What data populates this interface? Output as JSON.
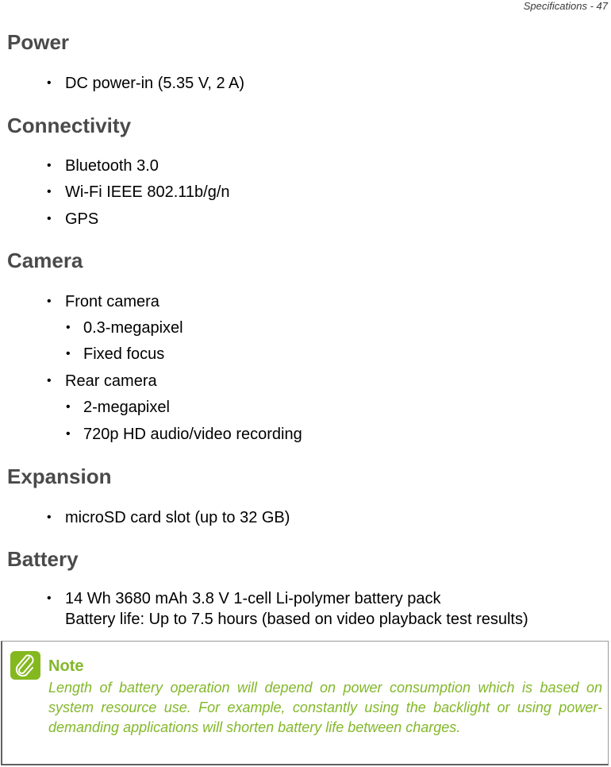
{
  "header": {
    "page_label": "Specifications - 47"
  },
  "sections": {
    "power": {
      "title": "Power",
      "items": [
        "DC power-in (5.35 V, 2 A)"
      ]
    },
    "connectivity": {
      "title": "Connectivity",
      "items": [
        "Bluetooth 3.0",
        "Wi-Fi IEEE 802.11b/g/n",
        "GPS"
      ]
    },
    "camera": {
      "title": "Camera",
      "front": {
        "label": "Front camera",
        "sub": [
          "0.3-megapixel",
          "Fixed focus"
        ]
      },
      "rear": {
        "label": "Rear camera",
        "sub": [
          "2-megapixel",
          "720p HD audio/video recording"
        ]
      }
    },
    "expansion": {
      "title": "Expansion",
      "items": [
        "microSD card slot (up to 32 GB)"
      ]
    },
    "battery": {
      "title": "Battery",
      "line1": "14 Wh 3680 mAh 3.8 V 1-cell Li-polymer battery pack",
      "line2": "Battery life: Up to 7.5 hours (based on video playback test results)"
    }
  },
  "note": {
    "icon": "paperclip-icon",
    "title": "Note",
    "text": "Length of battery operation will depend on power consumption which is based on system resource use. For example, constantly using the backlight or using power-demanding applications will shorten battery life between charges.",
    "color": "#83b82a"
  },
  "bullet_char": "•"
}
